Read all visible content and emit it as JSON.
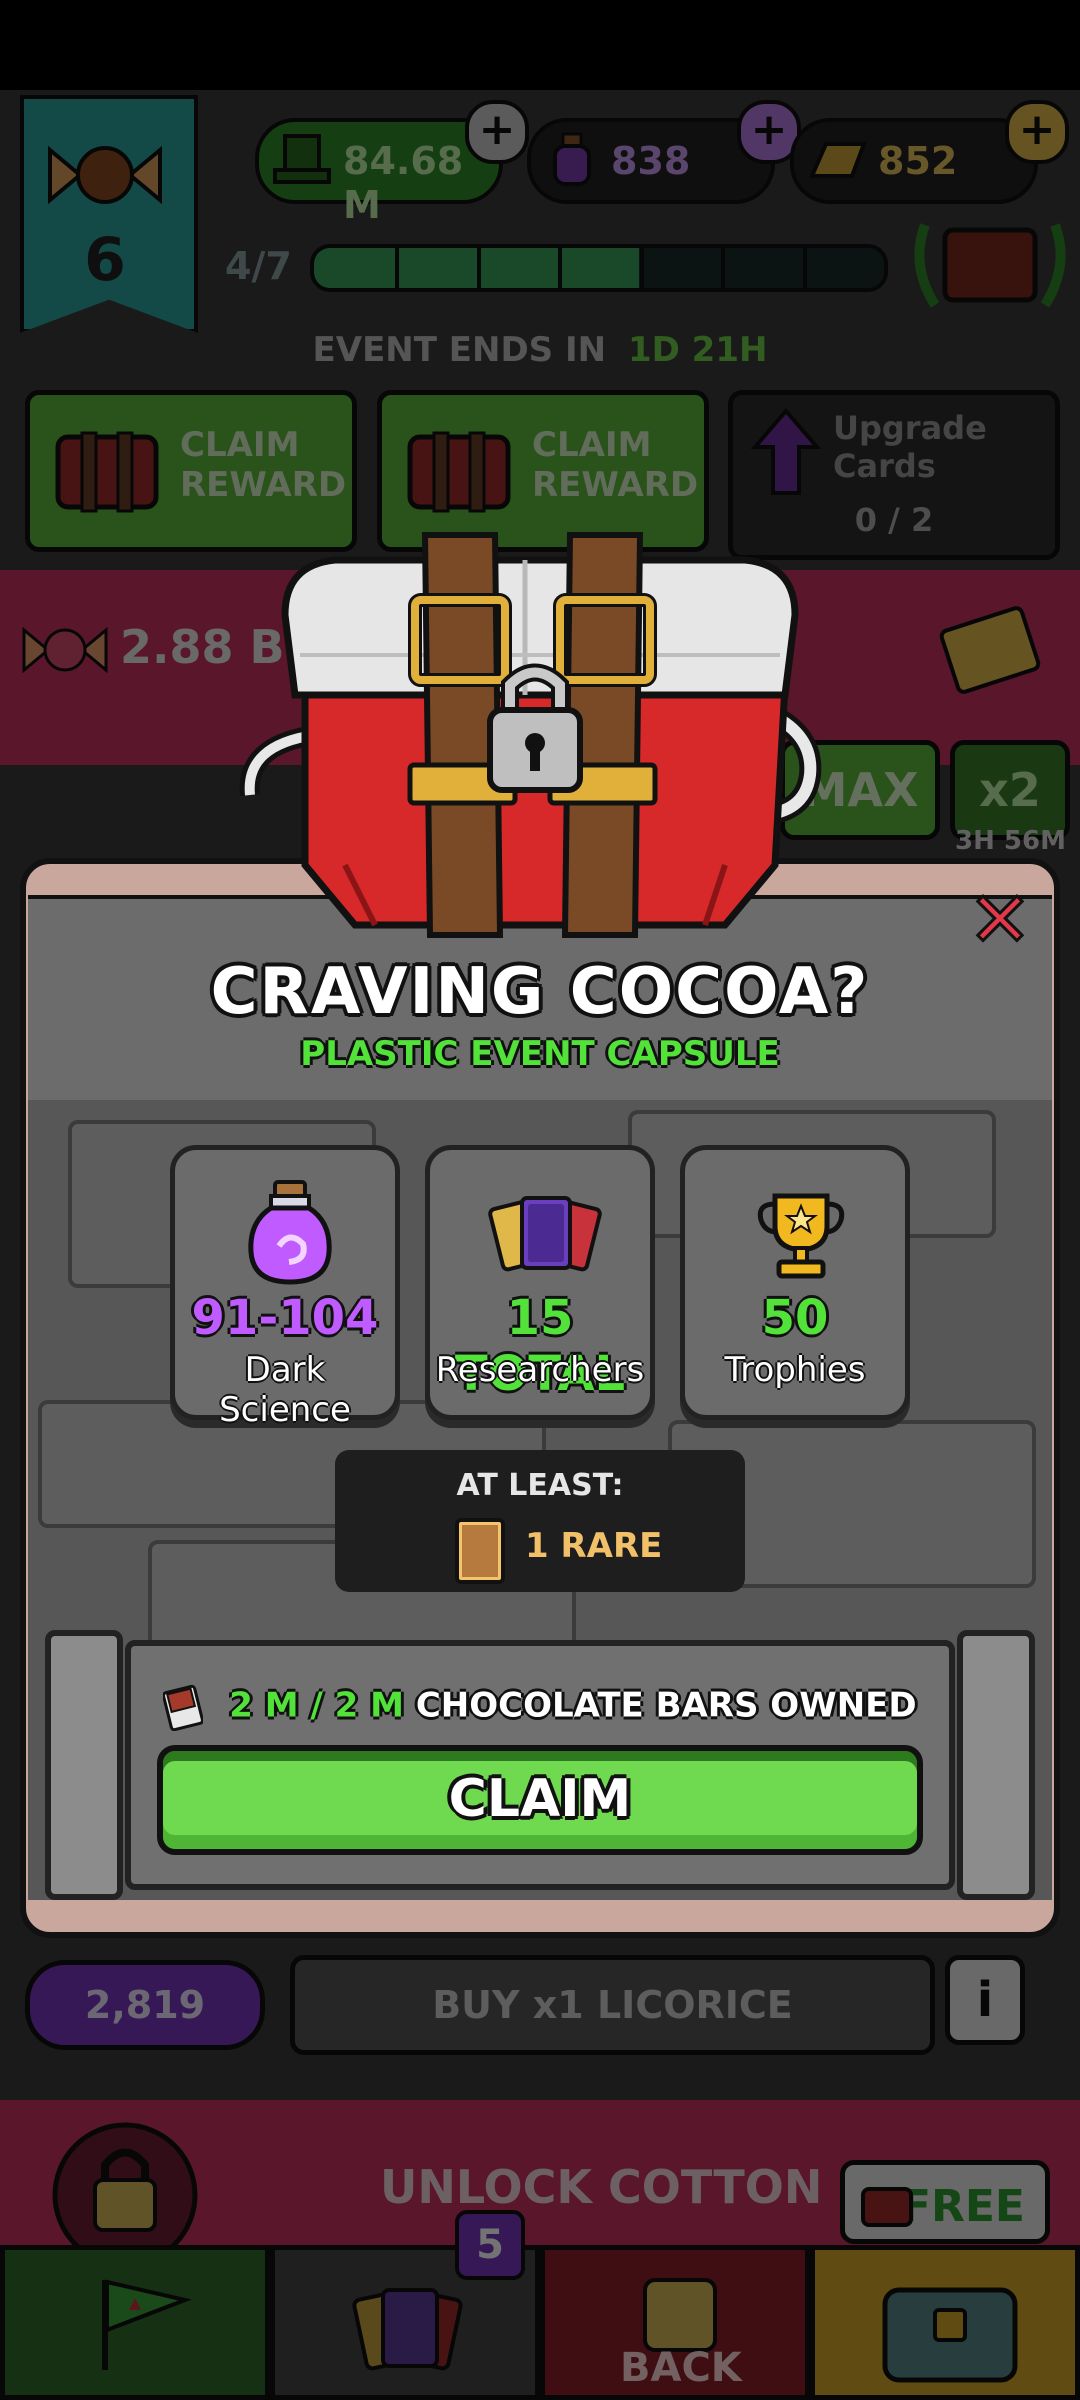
{
  "colors": {
    "accent_green": "#52e23a",
    "dark_science_purple": "#c05cff",
    "close_red": "#e2384a",
    "rare_gold": "#f3c06a",
    "modal_frame": "#c9a79c"
  },
  "header": {
    "level": "6",
    "currency_cash": "84.68 M",
    "currency_dark_science": "838",
    "currency_gold": "852",
    "progress_text": "4/7",
    "progress_fraction": 0.571
  },
  "event": {
    "ends_label": "EVENT ENDS IN",
    "ends_time": "1D 21H"
  },
  "tasks": [
    {
      "label_line1": "CLAIM",
      "label_line2": "REWARD"
    },
    {
      "label_line1": "CLAIM",
      "label_line2": "REWARD"
    },
    {
      "label_line1": "Upgrade",
      "label_line2": "Cards",
      "progress": "0 / 2"
    }
  ],
  "background": {
    "candy_count": "2.88 B",
    "max_label": "MAX",
    "x2_label": "x2",
    "timer": "3H 56M",
    "licorice_count": "2,819",
    "buy_label": "BUY x1 LICORICE",
    "info_icon": "info-icon",
    "unlock_label": "UNLOCK COTTON CAN",
    "free_label": "FREE",
    "nav_badge": "5",
    "back_label": "BACK"
  },
  "modal": {
    "title": "CRAVING COCOA?",
    "subtitle": "PLASTIC EVENT CAPSULE",
    "close_icon": "close-icon",
    "rewards": [
      {
        "value": "91-104",
        "label": "Dark Science",
        "icon": "potion-icon",
        "value_color": "#c05cff"
      },
      {
        "value": "15 TOTAL",
        "label": "Researchers",
        "icon": "cards-icon",
        "value_color": "#52e23a"
      },
      {
        "value": "50",
        "label": "Trophies",
        "icon": "trophy-icon",
        "value_color": "#52e23a"
      }
    ],
    "at_least_label": "AT LEAST:",
    "rare_label": "1 RARE",
    "owned_amount": "2 M / 2 M",
    "owned_label": "CHOCOLATE BARS OWNED",
    "claim_label": "CLAIM"
  }
}
